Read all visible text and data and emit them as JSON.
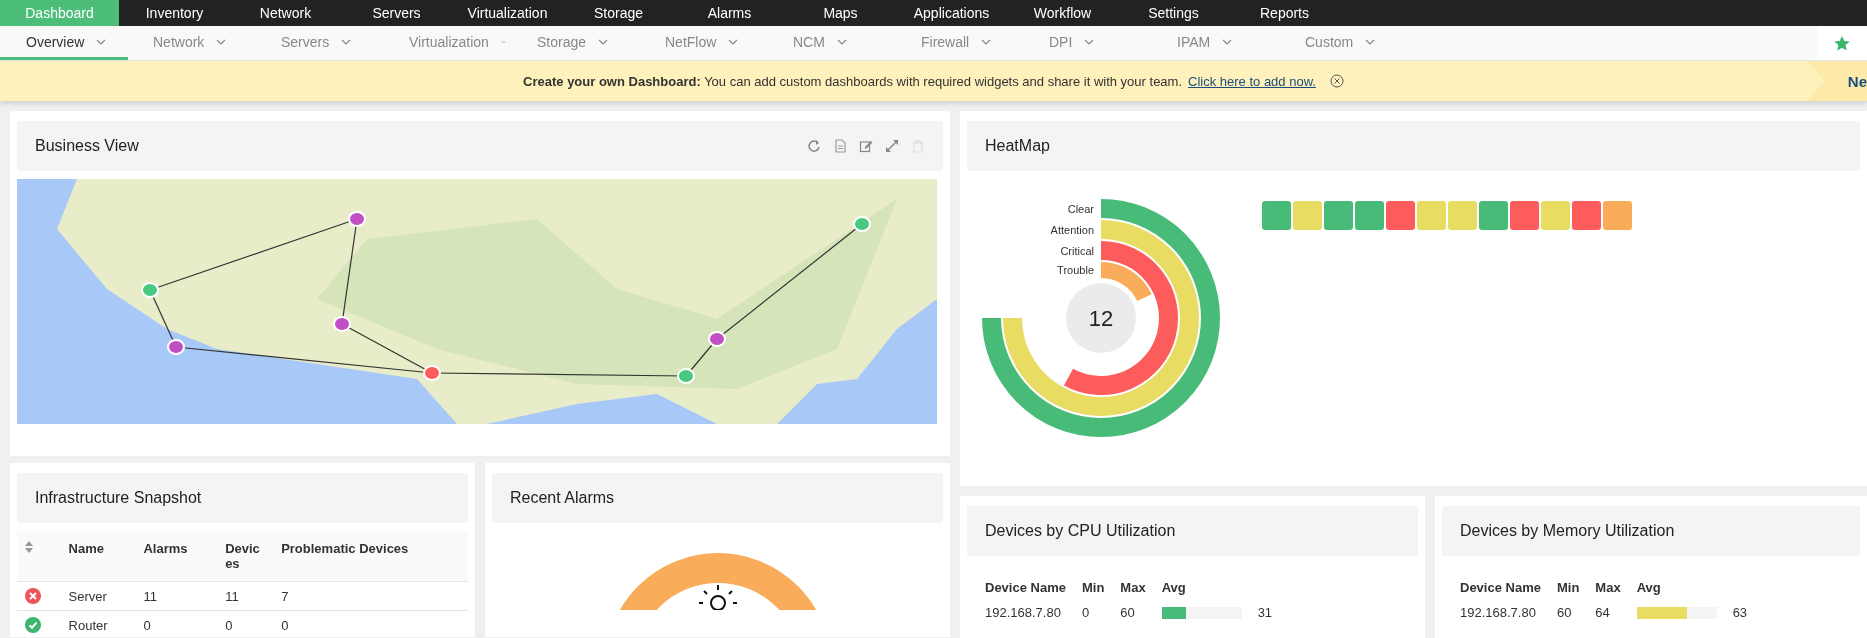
{
  "top_nav": [
    {
      "label": "Dashboard",
      "selected": true
    },
    {
      "label": "Inventory",
      "selected": false
    },
    {
      "label": "Network",
      "selected": false
    },
    {
      "label": "Servers",
      "selected": false
    },
    {
      "label": "Virtualization",
      "selected": false
    },
    {
      "label": "Storage",
      "selected": false
    },
    {
      "label": "Alarms",
      "selected": false
    },
    {
      "label": "Maps",
      "selected": false
    },
    {
      "label": "Applications",
      "selected": false
    },
    {
      "label": "Workflow",
      "selected": false
    },
    {
      "label": "Settings",
      "selected": false
    },
    {
      "label": "Reports",
      "selected": false
    }
  ],
  "sub_nav": [
    {
      "label": "Overview",
      "selected": true
    },
    {
      "label": "Network",
      "selected": false
    },
    {
      "label": "Servers",
      "selected": false
    },
    {
      "label": "Virtualization",
      "selected": false
    },
    {
      "label": "Storage",
      "selected": false
    },
    {
      "label": "NetFlow",
      "selected": false
    },
    {
      "label": "NCM",
      "selected": false
    },
    {
      "label": "Firewall",
      "selected": false
    },
    {
      "label": "DPI",
      "selected": false
    },
    {
      "label": "IPAM",
      "selected": false
    },
    {
      "label": "Custom",
      "selected": false
    }
  ],
  "banner": {
    "message": "**Create your own Dashboard:** You can add custom dashboards with required widgets and share it with your team.",
    "link": "Click here to add now.",
    "side_text": "Ne"
  },
  "business_view": {
    "title": "Business View"
  },
  "heatmap": {
    "title": "HeatMap",
    "total": "12",
    "rings": [
      {
        "label": "Clear",
        "color": "#48bb78"
      },
      {
        "label": "Attention",
        "color": "#e8dc63"
      },
      {
        "label": "Critical",
        "color": "#fc5c5c"
      },
      {
        "label": "Trouble",
        "color": "#f9ad5b"
      }
    ],
    "tiles": [
      {
        "color": "#48bb78"
      },
      {
        "color": "#e8dc63"
      },
      {
        "color": "#48bb78"
      },
      {
        "color": "#48bb78"
      },
      {
        "color": "#fc5c5c"
      },
      {
        "color": "#e8dc63"
      },
      {
        "color": "#e8dc63"
      },
      {
        "color": "#48bb78"
      },
      {
        "color": "#fc5c5c"
      },
      {
        "color": "#e8dc63"
      },
      {
        "color": "#fc5c5c"
      },
      {
        "color": "#f9ad5b"
      }
    ]
  },
  "infrastructure": {
    "title": "Infrastructure Snapshot",
    "columns": [
      "Name",
      "Alarms",
      "Devices",
      "Problematic Devices"
    ],
    "rows": [
      {
        "kind": "error",
        "name": "Server",
        "alarms": "11",
        "devices": "11",
        "problematic": "7"
      },
      {
        "kind": "ok",
        "name": "Router",
        "alarms": "0",
        "devices": "0",
        "problematic": "0"
      }
    ]
  },
  "recent_alarms": {
    "title": "Recent Alarms"
  },
  "cpu": {
    "title": "Devices by CPU Utilization",
    "columns": [
      "Device Name",
      "Min",
      "Max",
      "Avg"
    ],
    "rows": [
      {
        "device": "192.168.7.80",
        "min": "0",
        "max": "60",
        "level": 0.31,
        "color": "#48bb78",
        "avg": "31"
      }
    ]
  },
  "memory": {
    "title": "Devices by Memory Utilization",
    "columns": [
      "Device Name",
      "Min",
      "Max",
      "Avg"
    ],
    "rows": [
      {
        "device": "192.168.7.80",
        "min": "60",
        "max": "64",
        "level": 0.63,
        "color": "#e8dc63",
        "avg": "63"
      }
    ]
  }
}
